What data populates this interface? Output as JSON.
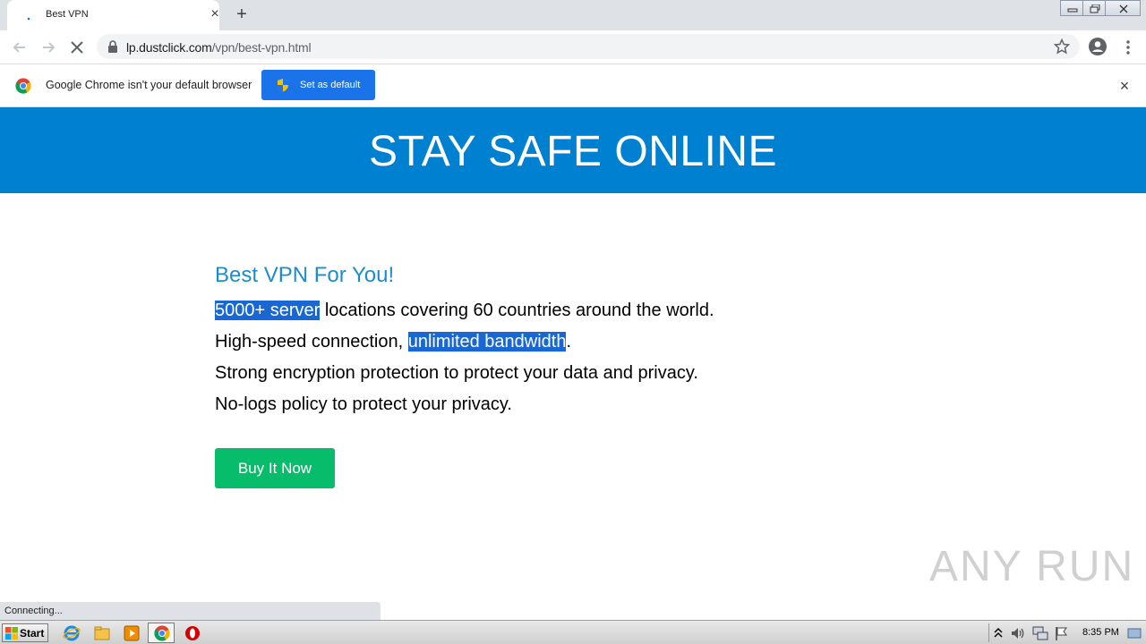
{
  "browser": {
    "tab_title": "Best VPN",
    "url_host": "lp.dustclick.com",
    "url_path": "/vpn/best-vpn.html",
    "status_text": "Connecting..."
  },
  "infobar": {
    "message": "Google Chrome isn't your default browser",
    "button_label": "Set as default"
  },
  "page": {
    "hero_title": "STAY SAFE ONLINE",
    "heading": "Best VPN For You!",
    "line1_selected": "5000+ server",
    "line1_rest": " locations covering 60 countries around the world.",
    "line2_start": "High-speed connection, ",
    "line2_selected": "unlimited bandwidth",
    "line2_end": ".",
    "line3": "Strong encryption protection to protect your data and privacy.",
    "line4": "No-logs policy to protect your privacy.",
    "buy_button": "Buy It Now",
    "watermark": "ANY RUN"
  },
  "taskbar": {
    "start_label": "Start",
    "clock": "8:35 PM"
  },
  "colors": {
    "hero_bg": "#0080d0",
    "heading": "#1c8ccd",
    "buy_button": "#07bd6b",
    "selection": "#1967d2",
    "chrome_button": "#1a73e8"
  }
}
